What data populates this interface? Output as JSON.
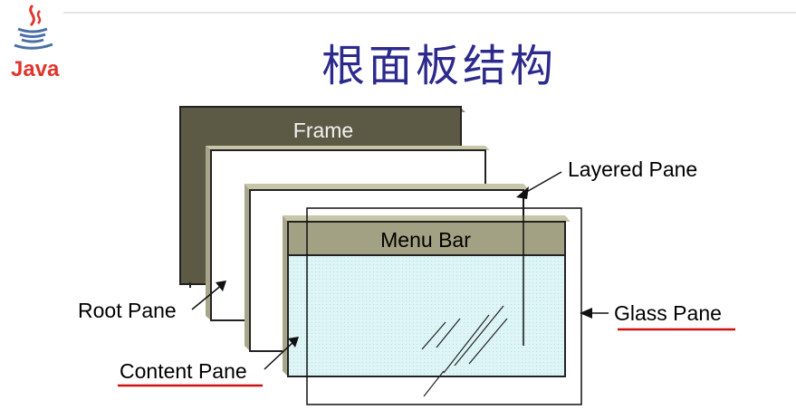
{
  "title": "根面板结构",
  "logo": {
    "name": "java-logo",
    "text": "Java",
    "color": "#e0352c"
  },
  "diagram": {
    "frame_label": "Frame",
    "menu_bar_label": "Menu Bar",
    "labels": {
      "layered_pane": "Layered Pane",
      "root_pane": "Root Pane",
      "content_pane": "Content Pane",
      "glass_pane": "Glass Pane"
    },
    "colors": {
      "frame_fill": "#5c5a45",
      "pane_edge": "#a8a68a",
      "menu_bar": "#a3a183",
      "content_fill": "#d8f4f4",
      "underline": "#cc1111"
    }
  }
}
